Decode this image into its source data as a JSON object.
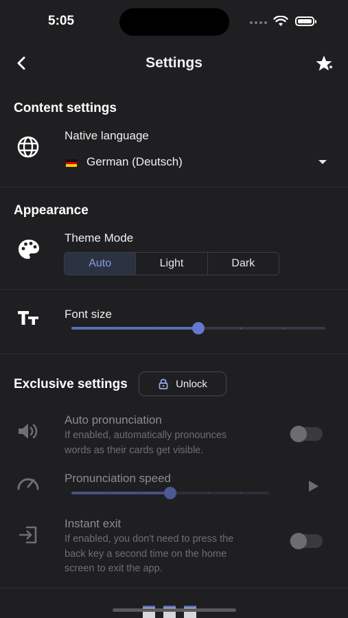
{
  "status": {
    "time": "5:05"
  },
  "header": {
    "title": "Settings"
  },
  "content_settings": {
    "title": "Content settings",
    "native_language_label": "Native language",
    "selected_language": "German (Deutsch)"
  },
  "appearance": {
    "title": "Appearance",
    "theme_label": "Theme Mode",
    "theme_options": [
      "Auto",
      "Light",
      "Dark"
    ],
    "theme_selected": "Auto",
    "font_size_label": "Font size",
    "font_size_level": 0.5
  },
  "exclusive": {
    "title": "Exclusive settings",
    "unlock_label": "Unlock",
    "auto_pron_title": "Auto pronunciation",
    "auto_pron_desc_1": "If enabled, automatically pronounces",
    "auto_pron_desc_2": "words as their cards get visible.",
    "speed_title": "Pronunciation speed",
    "speed_level": 0.5,
    "instant_exit_title": "Instant exit",
    "instant_exit_desc_1": "If enabled, you don't need to press the",
    "instant_exit_desc_2": "back key a second time on the home",
    "instant_exit_desc_3": "screen to exit the app."
  },
  "colors": {
    "accent": "#6478cf",
    "background": "#1f1f21",
    "active_segment": "#2b3242"
  }
}
